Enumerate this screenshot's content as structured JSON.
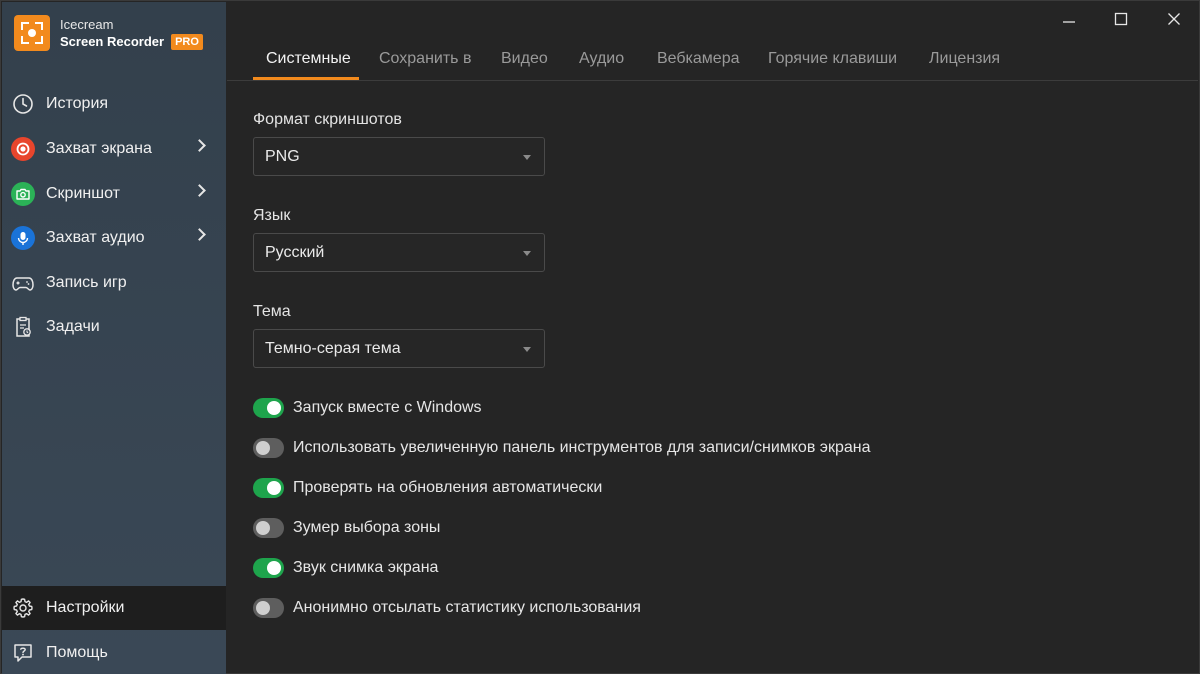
{
  "app": {
    "name": "Icecream",
    "product": "Screen Recorder",
    "badge": "PRO"
  },
  "sidebar": {
    "items": [
      {
        "label": "История",
        "icon": "clock-icon"
      },
      {
        "label": "Захват экрана",
        "icon": "record-icon"
      },
      {
        "label": "Скриншот",
        "icon": "camera-icon"
      },
      {
        "label": "Захват аудио",
        "icon": "microphone-icon"
      },
      {
        "label": "Запись игр",
        "icon": "gamepad-icon"
      },
      {
        "label": "Задачи",
        "icon": "task-clipboard-icon"
      }
    ],
    "bottom": [
      {
        "label": "Настройки",
        "icon": "gear-icon",
        "active": true
      },
      {
        "label": "Помощь",
        "icon": "help-icon"
      }
    ]
  },
  "tabs": [
    {
      "label": "Системные",
      "active": true
    },
    {
      "label": "Сохранить в"
    },
    {
      "label": "Видео"
    },
    {
      "label": "Аудио"
    },
    {
      "label": "Вебкамера"
    },
    {
      "label": "Горячие клавиши"
    },
    {
      "label": "Лицензия"
    }
  ],
  "settings": {
    "screenshot_format": {
      "label": "Формат скриншотов",
      "value": "PNG"
    },
    "language": {
      "label": "Язык",
      "value": "Русский"
    },
    "theme": {
      "label": "Тема",
      "value": "Темно-серая тема"
    },
    "toggles": [
      {
        "label": "Запуск вместе с Windows",
        "on": true
      },
      {
        "label": "Использовать увеличенную панель инструментов для записи/снимков экрана",
        "on": false
      },
      {
        "label": "Проверять на обновления автоматически",
        "on": true
      },
      {
        "label": "Зумер выбора зоны",
        "on": false
      },
      {
        "label": "Звук снимка экрана",
        "on": true
      },
      {
        "label": "Анонимно отсылать статистику использования",
        "on": false
      }
    ]
  },
  "colors": {
    "accent": "#f28a1d",
    "toggle_on": "#1ea44c",
    "record": "#e8452c",
    "screenshot": "#2bb257",
    "audio": "#1a73d8"
  }
}
